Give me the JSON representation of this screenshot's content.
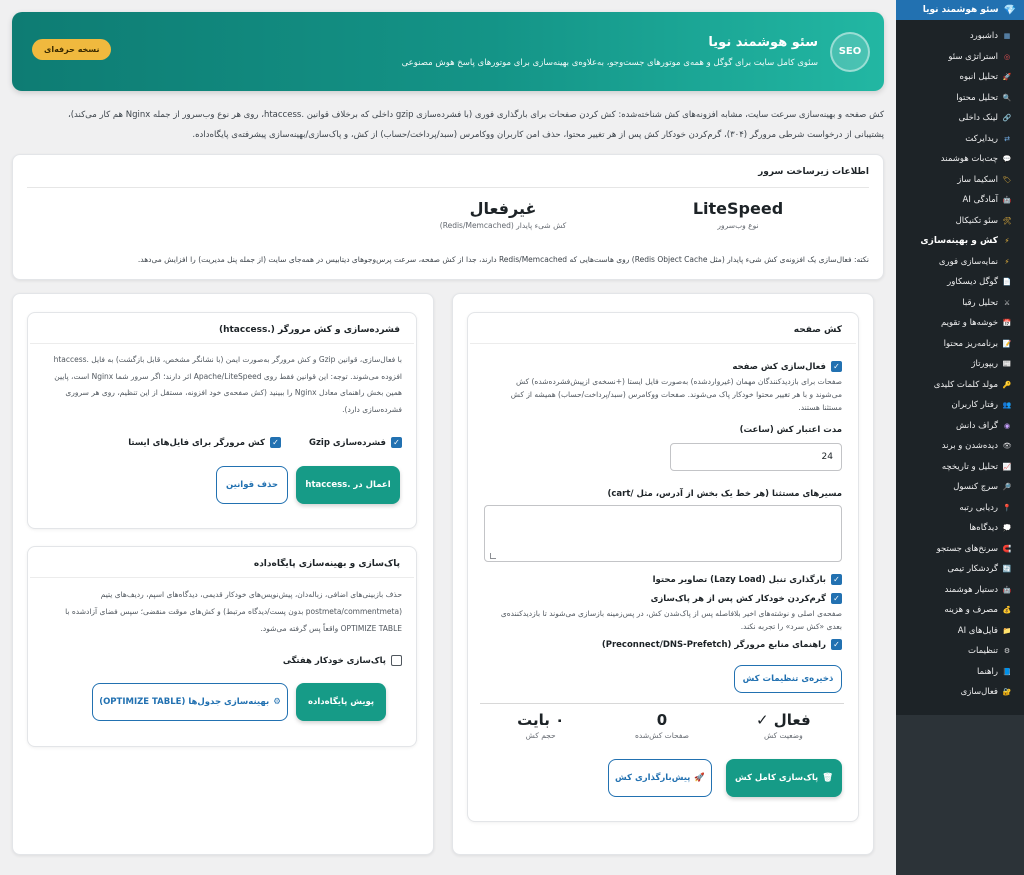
{
  "sidebar": {
    "header": "سئو هوشمند نویا",
    "items": [
      {
        "label": "داشبورد",
        "icon": "dashboard-icon",
        "color": "#72aee6"
      },
      {
        "label": "استراتژی سئو",
        "icon": "target-icon",
        "color": "#e65054"
      },
      {
        "label": "تحلیل انبوه",
        "icon": "rocket-icon",
        "color": "#c9a2ff"
      },
      {
        "label": "تحلیل محتوا",
        "icon": "magnifier-icon",
        "color": "#72aee6"
      },
      {
        "label": "لینک داخلی",
        "icon": "link-icon",
        "color": "#72aee6"
      },
      {
        "label": "ریدایرکت",
        "icon": "redirect-icon",
        "color": "#72aee6"
      },
      {
        "label": "چت‌بات هوشمند",
        "icon": "chat-icon",
        "color": "#72aee6"
      },
      {
        "label": "اسکیما ساز",
        "icon": "tag-icon",
        "color": "#f0b93e"
      },
      {
        "label": "آمادگی AI",
        "icon": "robot-icon",
        "color": "#72aee6"
      },
      {
        "label": "سئو تکنیکال",
        "icon": "tools-icon",
        "color": "#f0b93e"
      },
      {
        "label": "کش و بهینه‌سازی",
        "icon": "lightning-icon",
        "color": "#f0b93e",
        "active": true
      },
      {
        "label": "نمایه‌سازی فوری",
        "icon": "lightning-icon",
        "color": "#f0b93e"
      },
      {
        "label": "گوگل دیسکاور",
        "icon": "document-icon",
        "color": "#72aee6"
      },
      {
        "label": "تحلیل رقبا",
        "icon": "swords-icon",
        "color": "#dcdcde"
      },
      {
        "label": "خوشه‌ها و تقویم",
        "icon": "calendar-icon",
        "color": "#e65054"
      },
      {
        "label": "برنامه‌ریز محتوا",
        "icon": "notepad-icon",
        "color": "#72aee6"
      },
      {
        "label": "ریپورتاژ",
        "icon": "report-icon",
        "color": "#72aee6"
      },
      {
        "label": "مولد کلمات کلیدی",
        "icon": "key-icon",
        "color": "#f0b93e"
      },
      {
        "label": "رفتار کاربران",
        "icon": "users-icon",
        "color": "#72aee6"
      },
      {
        "label": "گراف دانش",
        "icon": "graph-icon",
        "color": "#c9a2ff"
      },
      {
        "label": "دیده‌شدن و برند",
        "icon": "eye-icon",
        "color": "#dcdcde"
      },
      {
        "label": "تحلیل و تاریخچه",
        "icon": "chart-icon",
        "color": "#e65054"
      },
      {
        "label": "سرچ کنسول",
        "icon": "search-icon",
        "color": "#72aee6"
      },
      {
        "label": "ردیابی رتبه",
        "icon": "pin-icon",
        "color": "#e65054"
      },
      {
        "label": "دیدگاه‌ها",
        "icon": "comment-icon",
        "color": "#72aee6"
      },
      {
        "label": "سرنخ‌های جستجو",
        "icon": "magnet-icon",
        "color": "#e65054"
      },
      {
        "label": "گردشکار تیمی",
        "icon": "workflow-icon",
        "color": "#72aee6"
      },
      {
        "label": "دستیار هوشمند",
        "icon": "assistant-icon",
        "color": "#72aee6"
      },
      {
        "label": "مصرف و هزینه",
        "icon": "money-bag-icon",
        "color": "#f0b93e"
      },
      {
        "label": "فایل‌های AI",
        "icon": "folder-icon",
        "color": "#72aee6"
      },
      {
        "label": "تنظیمات",
        "icon": "gear-icon",
        "color": "#dcdcde"
      },
      {
        "label": "راهنما",
        "icon": "book-icon",
        "color": "#72aee6"
      },
      {
        "label": "فعال‌سازی",
        "icon": "lock-icon",
        "color": "#f0b93e"
      }
    ]
  },
  "hero": {
    "badge": "SEO",
    "title": "سئو هوشمند نویا",
    "subtitle": "سئوی کامل سایت برای گوگل و همه‌ی موتورهای جست‌وجو، به‌علاوه‌ی بهینه‌سازی برای موتورهای پاسخ هوش مصنوعی",
    "pro_button": "نسخه حرفه‌ای"
  },
  "intro": {
    "line1": "کش صفحه و بهینه‌سازی سرعت سایت، مشابه افزونه‌های کش شناخته‌شده: کش کردن صفحات برای بارگذاری فوری (با فشرده‌سازی gzip داخلی که برخلاف قوانین .htaccess، روی هر نوع وب‌سرور از جمله Nginx هم کار می‌کند)،",
    "line2": "پشتیبانی از درخواست شرطی مرورگر (۳۰۴)، گرم‌کردن خودکار کش پس از هر تغییر محتوا، حذف امن کاربران ووکامرس (سبد/پرداخت/حساب) از کش، و پاک‌سازی/بهینه‌سازی پیشرفته‌ی پایگاه‌داده."
  },
  "infra": {
    "title": "اطلاعات زیرساخت سرور",
    "webserver_value": "LiteSpeed",
    "webserver_label": "نوع وب‌سرور",
    "objcache_value": "غیرفعال",
    "objcache_label": "کش شیء پایدار (Redis/Memcached)",
    "note": "نکته: فعال‌سازی یک افزونه‌ی کش شیء پایدار (مثل Redis Object Cache) روی هاست‌هایی که Redis/Memcached دارند، جدا از کش صفحه، سرعت پرس‌وجوهای دیتابیس در همه‌جای سایت (از جمله پنل مدیریت) را افزایش می‌دهد."
  },
  "page_cache": {
    "title": "کش صفحه",
    "enable_label": "فعال‌سازی کش صفحه",
    "enable_checked": true,
    "enable_desc": "صفحات برای بازدیدکنندگان مهمان (غیروارد‌شده) به‌صورت فایل ایستا (+نسخه‌ی ازپیش‌فشرده‌شده) کش می‌شوند و با هر تغییر محتوا خودکار پاک می‌شوند. صفحات ووکامرس (سبد/پرداخت/حساب) همیشه از کش مستثنا هستند.",
    "ttl_label": "مدت اعتبار کش (ساعت)",
    "ttl_value": "24",
    "exclude_label": "مسیرهای مستثنا (هر خط یک بخش از آدرس، مثل /cart)",
    "exclude_value": "",
    "lazy_label": "بارگذاری تنبل (Lazy Load) تصاویر محتوا",
    "lazy_checked": true,
    "warm_label": "گرم‌کردن خودکار کش پس از هر پاک‌سازی",
    "warm_checked": true,
    "warm_desc": "صفحه‌ی اصلی و نوشته‌های اخیر بلافاصله پس از پاک‌شدن کش، در پس‌زمینه بازسازی می‌شوند تا بازدیدکننده‌ی بعدی «کش سرد» را تجربه نکند.",
    "preconnect_label": "راهنمای منابع مرورگر (Preconnect/DNS-Prefetch)",
    "preconnect_checked": true,
    "save_button": "ذخیره‌ی تنظیمات کش",
    "stats": [
      {
        "value": "فعال ✓",
        "label": "وضعیت کش"
      },
      {
        "value": "0",
        "label": "صفحات کش‌شده"
      },
      {
        "value": "۰ بایت",
        "label": "حجم کش"
      }
    ],
    "purge_button": "پاک‌سازی کامل کش",
    "preload_button": "پیش‌بارگذاری کش"
  },
  "compression": {
    "title": "فشرده‌سازی و کش مرورگر (.htaccess)",
    "desc": "با فعال‌سازی، قوانین Gzip و کش مرورگر به‌صورت ایمن (با نشانگر مشخص، قابل بازگشت) به فایل .htaccess افزوده می‌شوند. توجه: این قوانین فقط روی Apache/LiteSpeed اثر دارند؛ اگر سرور شما Nginx است، پایین همین بخش راهنمای معادل Nginx را ببینید (کش صفحه‌ی خود افزونه، مستقل از این تنظیم، روی هر سروری فشرده‌سازی دارد).",
    "gzip_label": "فشرده‌سازی Gzip",
    "gzip_checked": true,
    "browser_label": "کش مرورگر برای فایل‌های ایستا",
    "browser_checked": true,
    "apply_button": "اعمال در .htaccess",
    "remove_button": "حذف قوانین"
  },
  "database": {
    "title": "پاک‌سازی و بهینه‌سازی پایگاه‌داده",
    "desc": "حذف بازبینی‌های اضافی، زباله‌دان، پیش‌نویس‌های خودکار قدیمی، دیدگاه‌های اسپم، ردیف‌های یتیم (postmeta/commentmeta بدون پست/دیدگاه مرتبط) و کش‌های موقت منقضی؛ سپس فضای آزادشده با OPTIMIZE TABLE واقعاً پس گرفته می‌شود.",
    "weekly_label": "پاک‌سازی خودکار هفتگی",
    "weekly_checked": false,
    "clean_button": "پویش پایگاه‌داده",
    "optimize_button": "بهینه‌سازی جدول‌ها (OPTIMIZE TABLE)"
  }
}
